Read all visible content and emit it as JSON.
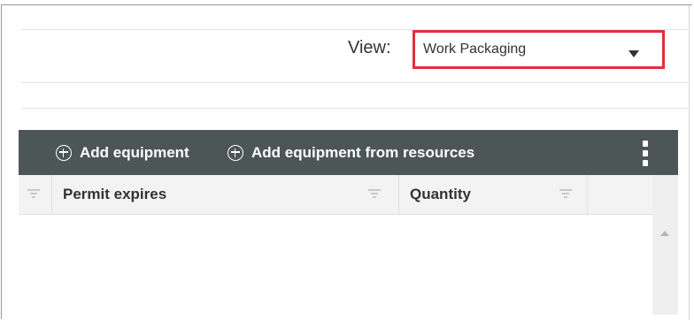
{
  "view": {
    "label": "View:",
    "selected": "Work Packaging"
  },
  "toolbar": {
    "add_equipment": "Add equipment",
    "add_equipment_from_resources": "Add equipment from resources"
  },
  "grid": {
    "columns": [
      "Permit expires",
      "Quantity"
    ]
  },
  "colors": {
    "toolbar_bg": "#4d5656",
    "highlight": "#e0313a"
  }
}
